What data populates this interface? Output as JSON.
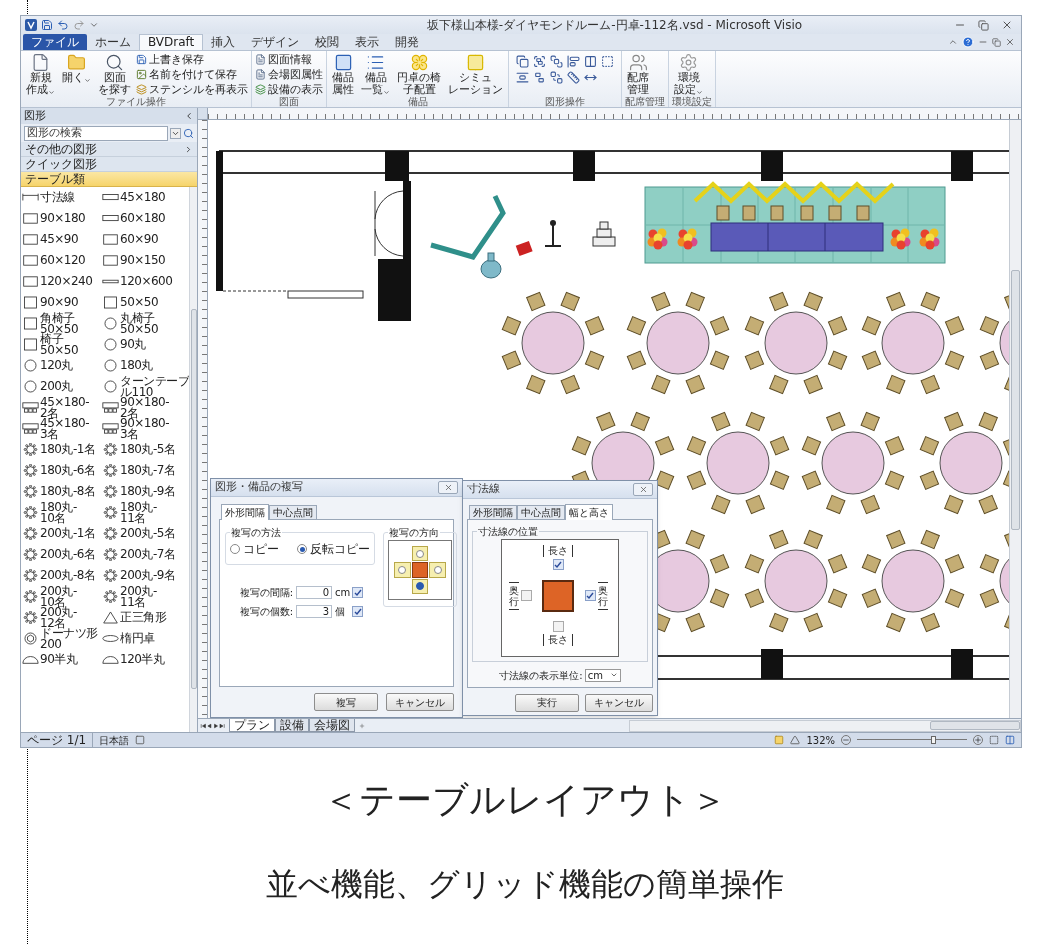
{
  "window": {
    "title": "坂下様山本様-ダイヤモンドルーム-円卓-112名.vsd - Microsoft Visio"
  },
  "ribbon_tabs": [
    {
      "label": "ファイル",
      "kind": "file",
      "selected": false
    },
    {
      "label": "ホーム",
      "kind": "tab",
      "selected": false
    },
    {
      "label": "BVDraft",
      "kind": "tab",
      "selected": true
    },
    {
      "label": "挿入",
      "kind": "tab",
      "selected": false
    },
    {
      "label": "デザイン",
      "kind": "tab",
      "selected": false
    },
    {
      "label": "校閲",
      "kind": "tab",
      "selected": false
    },
    {
      "label": "表示",
      "kind": "tab",
      "selected": false
    },
    {
      "label": "開発",
      "kind": "tab",
      "selected": false
    }
  ],
  "ribbon_groups": [
    {
      "label": "ファイル操作",
      "kind": "buttons",
      "buttons": [
        {
          "lines": [
            "新規",
            "作成"
          ],
          "kind": "large",
          "dropdown": true
        },
        {
          "lines": [
            "開く"
          ],
          "kind": "large",
          "dropdown": true
        },
        {
          "lines": [
            "図面",
            "を探す"
          ],
          "kind": "large",
          "dropdown": false
        },
        {
          "lines": [
            "上書き保存"
          ],
          "kind": "small",
          "dropdown": false
        },
        {
          "lines": [
            "名前を付けて保存"
          ],
          "kind": "small",
          "dropdown": false
        },
        {
          "lines": [
            "ステンシルを再表示"
          ],
          "kind": "small",
          "dropdown": false
        }
      ]
    },
    {
      "label": "図面",
      "kind": "buttons",
      "buttons": [
        {
          "lines": [
            "図面情報"
          ],
          "kind": "small",
          "dropdown": false
        },
        {
          "lines": [
            "会場図属性"
          ],
          "kind": "small",
          "dropdown": false
        },
        {
          "lines": [
            "設備の表示"
          ],
          "kind": "small",
          "dropdown": false
        }
      ]
    },
    {
      "label": "備品",
      "kind": "buttons",
      "buttons": [
        {
          "lines": [
            "備品",
            "属性"
          ],
          "kind": "large",
          "dropdown": false
        },
        {
          "lines": [
            "備品",
            "一覧"
          ],
          "kind": "large",
          "dropdown": true
        },
        {
          "lines": [
            "円卓の椅",
            "子配置"
          ],
          "kind": "large",
          "dropdown": false
        },
        {
          "lines": [
            "シミュ",
            "レーション"
          ],
          "kind": "large",
          "dropdown": false
        }
      ]
    },
    {
      "label": "図形操作",
      "kind": "icon_grid"
    },
    {
      "label": "配席管理",
      "kind": "buttons",
      "buttons": [
        {
          "lines": [
            "配席",
            "管理"
          ],
          "kind": "large",
          "dropdown": false
        }
      ]
    },
    {
      "label": "環境設定",
      "kind": "buttons",
      "buttons": [
        {
          "lines": [
            "環境",
            "設定"
          ],
          "kind": "large",
          "dropdown": true
        }
      ]
    }
  ],
  "shapes_panel": {
    "title": "図形",
    "search": {
      "placeholder": "図形の検索"
    },
    "sections": [
      {
        "label": "その他の図形",
        "kind": "menu",
        "selected": false
      },
      {
        "label": "クイック図形",
        "kind": "stencil",
        "selected": false
      },
      {
        "label": "テーブル類",
        "kind": "stencil",
        "selected": true
      }
    ],
    "shapes": [
      {
        "lines": [
          "寸法線"
        ],
        "kind": "dim"
      },
      {
        "lines": [
          "45×180"
        ],
        "kind": "wide"
      },
      {
        "lines": [
          "90×180"
        ],
        "kind": "rect"
      },
      {
        "lines": [
          "60×180"
        ],
        "kind": "wide"
      },
      {
        "lines": [
          "45×90"
        ],
        "kind": "rect"
      },
      {
        "lines": [
          "60×90"
        ],
        "kind": "rect"
      },
      {
        "lines": [
          "60×120"
        ],
        "kind": "rect"
      },
      {
        "lines": [
          "90×150"
        ],
        "kind": "rect"
      },
      {
        "lines": [
          "120×240"
        ],
        "kind": "rect"
      },
      {
        "lines": [
          "120×600"
        ],
        "kind": "bar"
      },
      {
        "lines": [
          "90×90"
        ],
        "kind": "square"
      },
      {
        "lines": [
          "50×50"
        ],
        "kind": "square"
      },
      {
        "lines": [
          "角椅子",
          "50×50"
        ],
        "kind": "square"
      },
      {
        "lines": [
          "丸椅子",
          "50×50"
        ],
        "kind": "circle"
      },
      {
        "lines": [
          "椅子",
          "50×50"
        ],
        "kind": "square"
      },
      {
        "lines": [
          "90丸"
        ],
        "kind": "circle"
      },
      {
        "lines": [
          "120丸"
        ],
        "kind": "circle"
      },
      {
        "lines": [
          "180丸"
        ],
        "kind": "circle"
      },
      {
        "lines": [
          "200丸"
        ],
        "kind": "circle"
      },
      {
        "lines": [
          "ターンテーブ",
          "ル110"
        ],
        "kind": "circle"
      },
      {
        "lines": [
          "45×180-",
          "2名"
        ],
        "kind": "rect_chairs"
      },
      {
        "lines": [
          "90×180-",
          "2名"
        ],
        "kind": "rect_chairs"
      },
      {
        "lines": [
          "45×180-",
          "3名"
        ],
        "kind": "rect_chairs"
      },
      {
        "lines": [
          "90×180-",
          "3名"
        ],
        "kind": "rect_chairs"
      },
      {
        "lines": [
          "180丸-1名"
        ],
        "kind": "round_chairs"
      },
      {
        "lines": [
          "180丸-5名"
        ],
        "kind": "round_chairs"
      },
      {
        "lines": [
          "180丸-6名"
        ],
        "kind": "round_chairs"
      },
      {
        "lines": [
          "180丸-7名"
        ],
        "kind": "round_chairs"
      },
      {
        "lines": [
          "180丸-8名"
        ],
        "kind": "round_chairs"
      },
      {
        "lines": [
          "180丸-9名"
        ],
        "kind": "round_chairs"
      },
      {
        "lines": [
          "180丸-",
          "10名"
        ],
        "kind": "round_chairs"
      },
      {
        "lines": [
          "180丸-",
          "11名"
        ],
        "kind": "round_chairs"
      },
      {
        "lines": [
          "200丸-1名"
        ],
        "kind": "round_chairs"
      },
      {
        "lines": [
          "200丸-5名"
        ],
        "kind": "round_chairs"
      },
      {
        "lines": [
          "200丸-6名"
        ],
        "kind": "round_chairs"
      },
      {
        "lines": [
          "200丸-7名"
        ],
        "kind": "round_chairs"
      },
      {
        "lines": [
          "200丸-8名"
        ],
        "kind": "round_chairs"
      },
      {
        "lines": [
          "200丸-9名"
        ],
        "kind": "round_chairs"
      },
      {
        "lines": [
          "200丸-",
          "10名"
        ],
        "kind": "round_chairs"
      },
      {
        "lines": [
          "200丸-",
          "11名"
        ],
        "kind": "round_chairs"
      },
      {
        "lines": [
          "200丸-",
          "12名"
        ],
        "kind": "round_chairs"
      },
      {
        "lines": [
          "正三角形"
        ],
        "kind": "triangle"
      },
      {
        "lines": [
          "ドーナツ形",
          "200"
        ],
        "kind": "donut"
      },
      {
        "lines": [
          "楕円卓"
        ],
        "kind": "ellipse"
      },
      {
        "lines": [
          "90半丸"
        ],
        "kind": "half"
      },
      {
        "lines": [
          "120半丸"
        ],
        "kind": "half"
      }
    ]
  },
  "copy_dialog": {
    "title": "図形・備品の複写",
    "tabs": [
      {
        "label": "外形間隔",
        "selected": true
      },
      {
        "label": "中心点間",
        "selected": false
      }
    ],
    "method": {
      "label": "複写の方法",
      "options": [
        {
          "label": "コピー",
          "selected": false
        },
        {
          "label": "反転コピー",
          "selected": true
        }
      ]
    },
    "fields": [
      {
        "label": "複写の間隔:",
        "value": "0",
        "unit": "cm",
        "checked": true
      },
      {
        "label": "複写の個数:",
        "value": "3",
        "unit": "個",
        "checked": true
      }
    ],
    "direction": {
      "label": "複写の方向",
      "options": [
        {
          "kind": "up",
          "selected": false
        },
        {
          "kind": "left",
          "selected": false
        },
        {
          "kind": "right",
          "selected": false
        },
        {
          "kind": "down",
          "selected": true
        }
      ]
    },
    "buttons": [
      "複写",
      "キャンセル"
    ]
  },
  "dimension_dialog": {
    "title": "寸法線",
    "tabs": [
      {
        "label": "外形間隔",
        "selected": false
      },
      {
        "label": "中心点間",
        "selected": false
      },
      {
        "label": "幅と高さ",
        "selected": true
      }
    ],
    "position": {
      "label": "寸法線の位置",
      "sides": [
        {
          "kind": "top",
          "label": "長さ",
          "checked": true
        },
        {
          "kind": "left",
          "label": "奥行",
          "checked": false
        },
        {
          "kind": "right",
          "label": "奥行",
          "checked": true
        },
        {
          "kind": "bottom",
          "label": "長さ",
          "checked": false
        }
      ]
    },
    "unit": {
      "label": "寸法線の表示単位:",
      "value": "cm"
    },
    "buttons": [
      "実行",
      "キャンセル"
    ]
  },
  "page_tabs": [
    {
      "label": "プラン",
      "selected": true
    },
    {
      "label": "設備",
      "selected": false
    },
    {
      "label": "会場図",
      "selected": false
    }
  ],
  "status_bar": {
    "page": "ページ 1/1",
    "language": "日本語",
    "zoom": "132%",
    "zoom_slider": {
      "level": 0.7
    }
  },
  "captions": {
    "title": "＜テーブルレイアウト＞",
    "subtitle": "並べ機能、グリッド機能の簡単操作"
  }
}
